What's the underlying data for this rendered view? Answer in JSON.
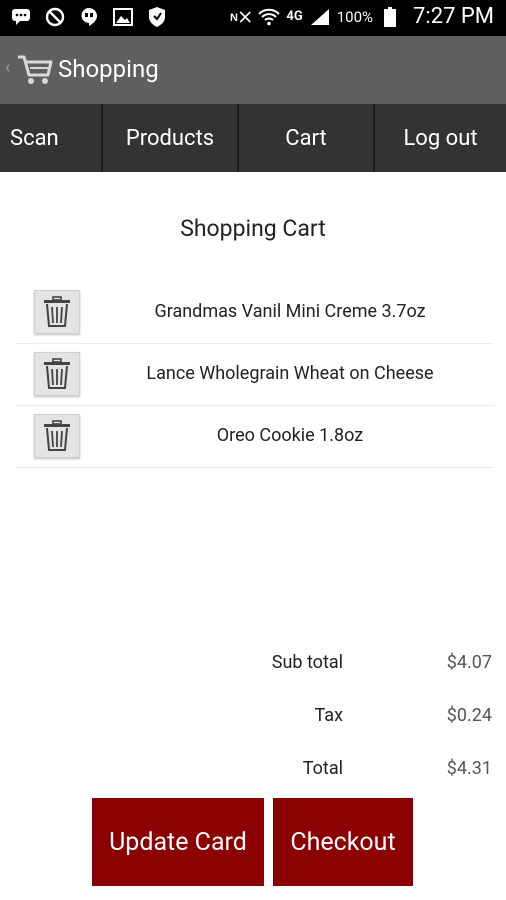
{
  "status_bar": {
    "network": "4G",
    "battery": "100%",
    "time": "7:27 PM"
  },
  "action_bar": {
    "title": "Shopping",
    "back_glyph": "‹"
  },
  "tabs": [
    {
      "label": "Scan"
    },
    {
      "label": "Products"
    },
    {
      "label": "Cart"
    },
    {
      "label": "Log out"
    }
  ],
  "cart": {
    "heading": "Shopping Cart",
    "items": [
      {
        "name": "Grandmas Vanil Mini Creme 3.7oz"
      },
      {
        "name": "Lance Wholegrain Wheat on Cheese"
      },
      {
        "name": "Oreo Cookie 1.8oz"
      }
    ]
  },
  "totals": {
    "subtotal_label": "Sub total",
    "subtotal_value": "$4.07",
    "tax_label": "Tax",
    "tax_value": "$0.24",
    "total_label": "Total",
    "total_value": "$4.31"
  },
  "buttons": {
    "update": "Update Card",
    "checkout": "Checkout"
  },
  "icons": {
    "cart": "shopping-cart-icon",
    "trash": "trash-icon"
  },
  "colors": {
    "action_bar": "#5f5f5f",
    "tab_bg": "#333333",
    "button_bg": "#8b0000"
  }
}
